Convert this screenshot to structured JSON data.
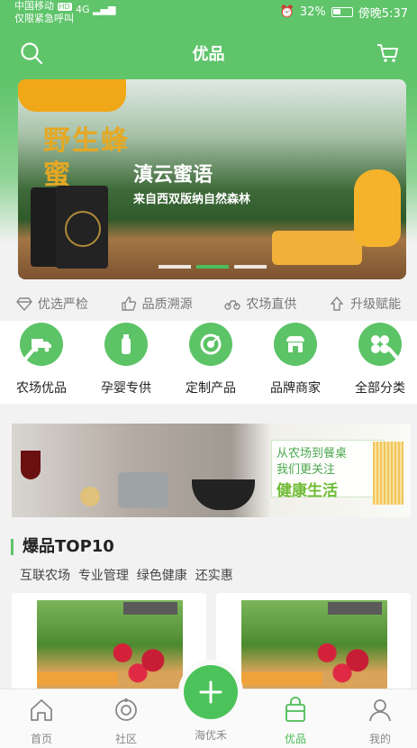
{
  "status": {
    "carrier": "中国移动",
    "carrier_badge": "HD",
    "emergency": "仅限紧急呼叫",
    "signal_text": "4G",
    "battery_text": "32%",
    "time": "傍晚5:37"
  },
  "header": {
    "title": "优品"
  },
  "banner": {
    "headline": "野生蜂蜜",
    "slogan": "滇云蜜语",
    "sub": "来自西双版纳自然森林",
    "slides": 3,
    "active_slide": 2
  },
  "features": [
    {
      "label": "优选严检",
      "icon": "diamond-icon"
    },
    {
      "label": "品质溯源",
      "icon": "thumbs-up-icon"
    },
    {
      "label": "农场直供",
      "icon": "bike-icon"
    },
    {
      "label": "升级赋能",
      "icon": "arrow-up-icon"
    }
  ],
  "categories": [
    {
      "label": "农场优品",
      "icon": "truck-icon"
    },
    {
      "label": "孕婴专供",
      "icon": "bottle-icon"
    },
    {
      "label": "定制产品",
      "icon": "target-icon"
    },
    {
      "label": "品牌商家",
      "icon": "store-icon"
    },
    {
      "label": "全部分类",
      "icon": "grid-icon"
    }
  ],
  "promo": {
    "line1": "从农场到餐桌",
    "line2": "我们更关注",
    "line3": "健康生活"
  },
  "section": {
    "title": "爆品TOP10",
    "subtitle": "互联农场  专业管理  绿色健康  还实惠"
  },
  "tabs": [
    {
      "label": "首页",
      "icon": "home-icon"
    },
    {
      "label": "社区",
      "icon": "community-icon"
    },
    {
      "label": "海优禾",
      "icon": "plus-icon"
    },
    {
      "label": "优品",
      "icon": "bag-icon"
    },
    {
      "label": "我的",
      "icon": "user-icon"
    }
  ],
  "colors": {
    "brand_green": "#5fc46a",
    "active_green": "#4cbd55"
  }
}
